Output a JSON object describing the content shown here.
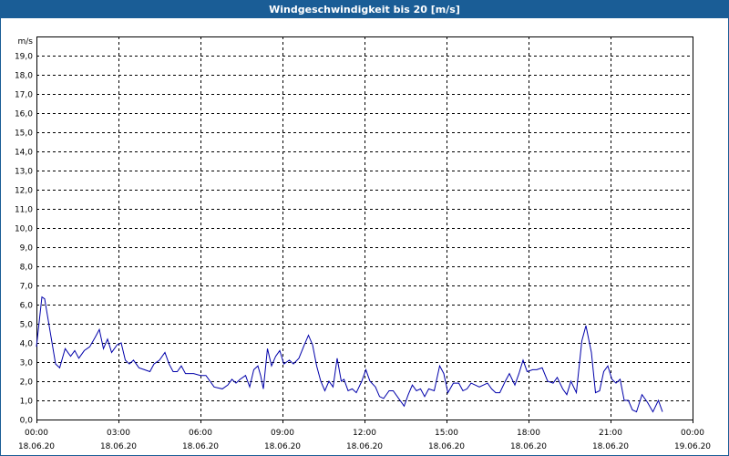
{
  "window": {
    "title": "Windgeschwindigkeit bis 20 [m/s]"
  },
  "colors": {
    "titlebar": "#1a5d96",
    "line": "#0000aa",
    "grid": "#000000"
  },
  "chart_data": {
    "type": "line",
    "title": "Windgeschwindigkeit bis 20 [m/s]",
    "ylabel": "m/s",
    "ylim": [
      0,
      20
    ],
    "yticks": [
      "0,0",
      "1,0",
      "2,0",
      "3,0",
      "4,0",
      "5,0",
      "6,0",
      "7,0",
      "8,0",
      "9,0",
      "10,0",
      "11,0",
      "12,0",
      "13,0",
      "14,0",
      "15,0",
      "16,0",
      "17,0",
      "18,0",
      "19,0"
    ],
    "xlim": [
      0,
      24
    ],
    "xticks": [
      {
        "time": "00:00",
        "date": "18.06.20"
      },
      {
        "time": "03:00",
        "date": "18.06.20"
      },
      {
        "time": "06:00",
        "date": "18.06.20"
      },
      {
        "time": "09:00",
        "date": "18.06.20"
      },
      {
        "time": "12:00",
        "date": "18.06.20"
      },
      {
        "time": "15:00",
        "date": "18.06.20"
      },
      {
        "time": "18:00",
        "date": "18.06.20"
      },
      {
        "time": "21:00",
        "date": "18.06.20"
      },
      {
        "time": "00:00",
        "date": "19.06.20"
      }
    ],
    "grid": true,
    "series": [
      {
        "points": [
          [
            0.0,
            3.8
          ],
          [
            0.2,
            6.4
          ],
          [
            0.3,
            6.3
          ],
          [
            0.5,
            4.6
          ],
          [
            0.7,
            2.9
          ],
          [
            0.85,
            2.7
          ],
          [
            1.05,
            3.7
          ],
          [
            1.25,
            3.3
          ],
          [
            1.4,
            3.6
          ],
          [
            1.55,
            3.2
          ],
          [
            1.75,
            3.6
          ],
          [
            1.95,
            3.8
          ],
          [
            2.15,
            4.3
          ],
          [
            2.3,
            4.7
          ],
          [
            2.45,
            3.7
          ],
          [
            2.6,
            4.2
          ],
          [
            2.75,
            3.5
          ],
          [
            2.95,
            3.9
          ],
          [
            3.1,
            4.0
          ],
          [
            3.25,
            3.1
          ],
          [
            3.4,
            2.9
          ],
          [
            3.55,
            3.1
          ],
          [
            3.75,
            2.7
          ],
          [
            3.95,
            2.6
          ],
          [
            4.15,
            2.5
          ],
          [
            4.3,
            2.9
          ],
          [
            4.5,
            3.1
          ],
          [
            4.7,
            3.5
          ],
          [
            4.85,
            2.9
          ],
          [
            5.0,
            2.5
          ],
          [
            5.15,
            2.5
          ],
          [
            5.3,
            2.8
          ],
          [
            5.45,
            2.4
          ],
          [
            5.6,
            2.4
          ],
          [
            5.75,
            2.4
          ],
          [
            6.0,
            2.3
          ],
          [
            6.2,
            2.3
          ],
          [
            6.5,
            1.7
          ],
          [
            6.8,
            1.6
          ],
          [
            7.0,
            1.8
          ],
          [
            7.15,
            2.1
          ],
          [
            7.3,
            1.9
          ],
          [
            7.45,
            2.1
          ],
          [
            7.65,
            2.3
          ],
          [
            7.8,
            1.7
          ],
          [
            7.95,
            2.6
          ],
          [
            8.1,
            2.8
          ],
          [
            8.2,
            2.3
          ],
          [
            8.3,
            1.6
          ],
          [
            8.45,
            3.7
          ],
          [
            8.6,
            2.8
          ],
          [
            8.75,
            3.3
          ],
          [
            8.9,
            3.6
          ],
          [
            9.05,
            2.9
          ],
          [
            9.25,
            3.1
          ],
          [
            9.4,
            2.9
          ],
          [
            9.6,
            3.2
          ],
          [
            9.8,
            3.9
          ],
          [
            9.95,
            4.4
          ],
          [
            10.1,
            3.9
          ],
          [
            10.25,
            2.8
          ],
          [
            10.4,
            2.0
          ],
          [
            10.55,
            1.5
          ],
          [
            10.7,
            2.0
          ],
          [
            10.85,
            1.7
          ],
          [
            11.0,
            3.2
          ],
          [
            11.15,
            2.0
          ],
          [
            11.25,
            2.1
          ],
          [
            11.4,
            1.5
          ],
          [
            11.55,
            1.6
          ],
          [
            11.7,
            1.4
          ],
          [
            11.9,
            2.0
          ],
          [
            12.05,
            2.6
          ],
          [
            12.2,
            2.0
          ],
          [
            12.4,
            1.7
          ],
          [
            12.55,
            1.2
          ],
          [
            12.7,
            1.1
          ],
          [
            12.9,
            1.5
          ],
          [
            13.05,
            1.5
          ],
          [
            13.25,
            1.1
          ],
          [
            13.45,
            0.7
          ],
          [
            13.6,
            1.3
          ],
          [
            13.75,
            1.8
          ],
          [
            13.9,
            1.5
          ],
          [
            14.05,
            1.6
          ],
          [
            14.2,
            1.2
          ],
          [
            14.35,
            1.6
          ],
          [
            14.55,
            1.5
          ],
          [
            14.75,
            2.8
          ],
          [
            14.9,
            2.4
          ],
          [
            15.05,
            1.4
          ],
          [
            15.25,
            1.9
          ],
          [
            15.45,
            1.9
          ],
          [
            15.6,
            1.5
          ],
          [
            15.75,
            1.6
          ],
          [
            15.9,
            1.9
          ],
          [
            16.05,
            1.8
          ],
          [
            16.2,
            1.7
          ],
          [
            16.35,
            1.8
          ],
          [
            16.5,
            1.9
          ],
          [
            16.65,
            1.6
          ],
          [
            16.8,
            1.4
          ],
          [
            16.95,
            1.4
          ],
          [
            17.15,
            2.0
          ],
          [
            17.3,
            2.4
          ],
          [
            17.5,
            1.8
          ],
          [
            17.65,
            2.4
          ],
          [
            17.8,
            3.1
          ],
          [
            17.95,
            2.5
          ],
          [
            18.15,
            2.6
          ],
          [
            18.3,
            2.6
          ],
          [
            18.5,
            2.7
          ],
          [
            18.7,
            2.0
          ],
          [
            18.9,
            1.9
          ],
          [
            19.05,
            2.2
          ],
          [
            19.25,
            1.6
          ],
          [
            19.4,
            1.3
          ],
          [
            19.55,
            2.0
          ],
          [
            19.75,
            1.4
          ],
          [
            19.95,
            4.1
          ],
          [
            20.1,
            4.9
          ],
          [
            20.3,
            3.5
          ],
          [
            20.45,
            1.4
          ],
          [
            20.6,
            1.5
          ],
          [
            20.75,
            2.5
          ],
          [
            20.9,
            2.8
          ],
          [
            21.05,
            2.1
          ],
          [
            21.2,
            1.9
          ],
          [
            21.35,
            2.1
          ],
          [
            21.5,
            1.0
          ],
          [
            21.65,
            1.0
          ],
          [
            21.8,
            0.5
          ],
          [
            21.95,
            0.4
          ],
          [
            22.15,
            1.3
          ],
          [
            22.35,
            0.9
          ],
          [
            22.55,
            0.4
          ],
          [
            22.75,
            1.0
          ],
          [
            22.9,
            0.4
          ]
        ]
      }
    ]
  }
}
